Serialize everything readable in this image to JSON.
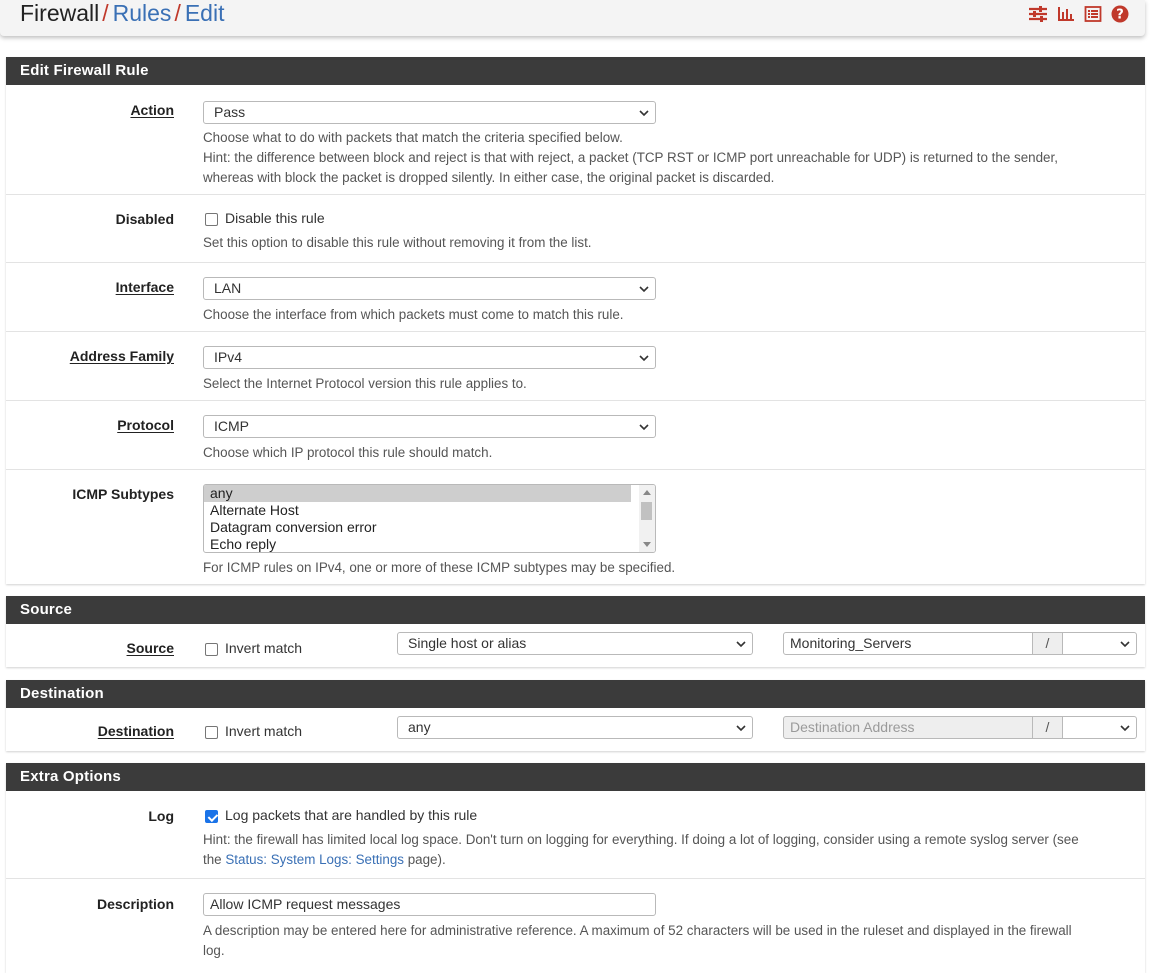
{
  "breadcrumb": {
    "root": "Firewall",
    "sep": "/",
    "rules": "Rules",
    "edit": "Edit"
  },
  "header_icons": [
    "sliders-icon",
    "chart-icon",
    "list-icon",
    "help-icon"
  ],
  "colors": {
    "accent_red": "#c0392b",
    "link_blue": "#3a70b5",
    "panel_header": "#3b3b3b",
    "checkbox_checked": "#1a73e8"
  },
  "edit_panel": {
    "title": "Edit Firewall Rule",
    "action": {
      "label": "Action",
      "value": "Pass",
      "help1": "Choose what to do with packets that match the criteria specified below.",
      "help2": "Hint: the difference between block and reject is that with reject, a packet (TCP RST or ICMP port unreachable for UDP) is returned to the sender,",
      "help3": "whereas with block the packet is dropped silently. In either case, the original packet is discarded."
    },
    "disabled": {
      "label": "Disabled",
      "checkbox_label": "Disable this rule",
      "checked": false,
      "help": "Set this option to disable this rule without removing it from the list."
    },
    "interface": {
      "label": "Interface",
      "value": "LAN",
      "help": "Choose the interface from which packets must come to match this rule."
    },
    "address_family": {
      "label": "Address Family",
      "value": "IPv4",
      "help": "Select the Internet Protocol version this rule applies to."
    },
    "protocol": {
      "label": "Protocol",
      "value": "ICMP",
      "help": "Choose which IP protocol this rule should match."
    },
    "icmp_subtypes": {
      "label": "ICMP Subtypes",
      "options": [
        "any",
        "Alternate Host",
        "Datagram conversion error",
        "Echo reply"
      ],
      "selected": "any",
      "help": "For ICMP rules on IPv4, one or more of these ICMP subtypes may be specified."
    }
  },
  "source_panel": {
    "title": "Source",
    "label": "Source",
    "invert_label": "Invert match",
    "invert_checked": false,
    "type": "Single host or alias",
    "address": "Monitoring_Servers",
    "slash": "/",
    "mask": ""
  },
  "destination_panel": {
    "title": "Destination",
    "label": "Destination",
    "invert_label": "Invert match",
    "invert_checked": false,
    "type": "any",
    "address_placeholder": "Destination Address",
    "slash": "/",
    "mask": ""
  },
  "extra_panel": {
    "title": "Extra Options",
    "log": {
      "label": "Log",
      "checkbox_label": "Log packets that are handled by this rule",
      "checked": true,
      "help1": "Hint: the firewall has limited local log space. Don't turn on logging for everything. If doing a lot of logging, consider using a remote syslog server (see",
      "help2_pre": "the ",
      "help2_link": "Status: System Logs: Settings",
      "help2_post": " page)."
    },
    "description": {
      "label": "Description",
      "value": "Allow ICMP request messages",
      "help1": "A description may be entered here for administrative reference. A maximum of 52 characters will be used in the ruleset and displayed in the firewall",
      "help2": "log."
    }
  }
}
